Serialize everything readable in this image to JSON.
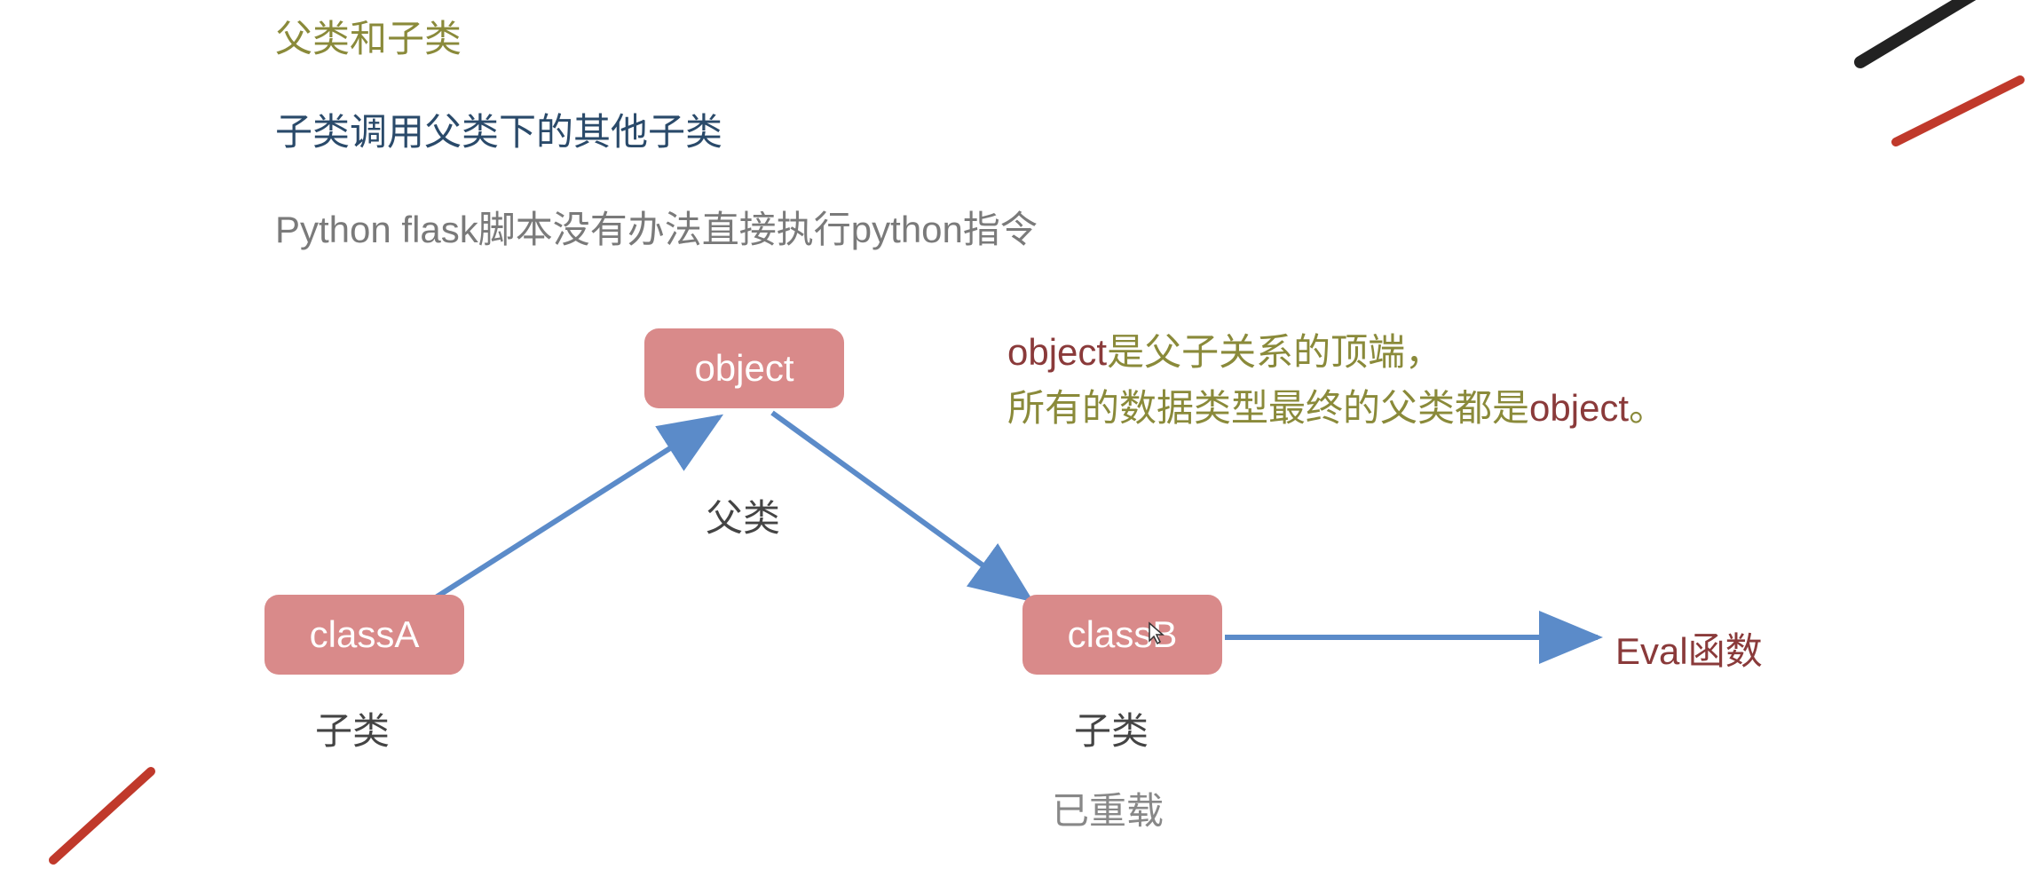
{
  "titles": {
    "main": "父类和子类",
    "sub": "子类调用父类下的其他子类",
    "note": "Python flask脚本没有办法直接执行python指令"
  },
  "nodes": {
    "object": "object",
    "classA": "classA",
    "classB": "classB"
  },
  "labels": {
    "parent": "父类",
    "childA": "子类",
    "childB": "子类",
    "reload": "已重载",
    "eval": "Eval函数"
  },
  "description": {
    "line1_accent": "object",
    "line1_rest": "是父子关系的顶端，",
    "line2_pre": "所有的数据类型最终的父类都是",
    "line2_accent": "object",
    "line2_post": "。"
  },
  "colors": {
    "nodeBg": "#d98a8a",
    "arrow": "#5b8bc9",
    "olive": "#8a8a3a",
    "maroon": "#8a3a3a"
  }
}
